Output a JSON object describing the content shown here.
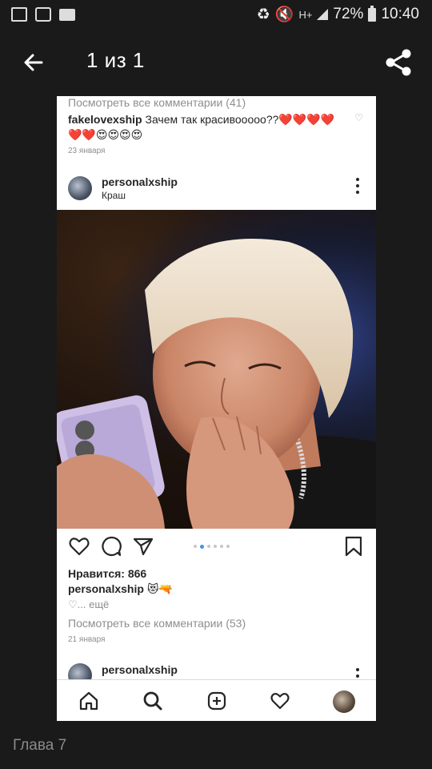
{
  "status_bar": {
    "network": "H+",
    "battery": "72%",
    "time": "10:40"
  },
  "appbar": {
    "title": "1 из 1"
  },
  "card": {
    "top_comment": {
      "view_all": "Посмотреть все комментарии (41)",
      "user": "fakelovexship",
      "text": "Зачем так красивооооо??❤️❤️❤️❤️❤️❤️😍😍😍😍",
      "date": "23 января"
    },
    "post": {
      "username": "personalxship",
      "location": "Краш",
      "likes": "Нравится: 866",
      "caption_user": "personalxship",
      "caption_text": "😻🔫",
      "more": "♡... ещё",
      "view_all": "Посмотреть все комментарии (53)",
      "date": "21 января",
      "carousel": {
        "pages": 6,
        "current": 1
      }
    },
    "next_post": {
      "username": "personalxship"
    }
  },
  "footer": {
    "chapter": "Глава 7"
  }
}
